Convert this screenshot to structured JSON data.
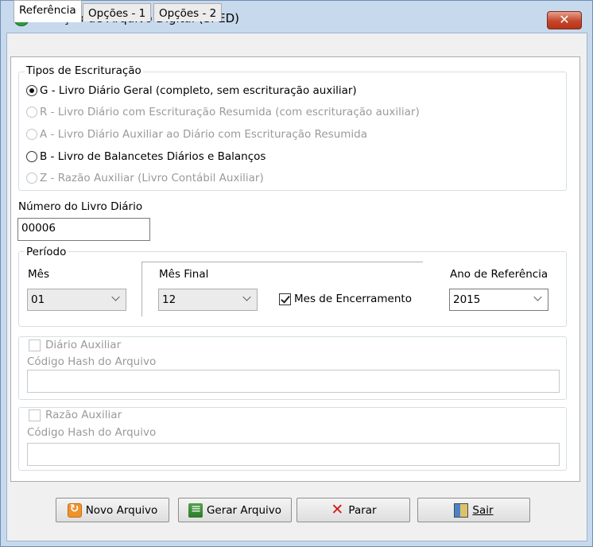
{
  "window": {
    "title": "Geração de Arquivo Digital (SPED)",
    "close_glyph": "✕"
  },
  "tabs": [
    {
      "label": "Referência",
      "active": true
    },
    {
      "label": "Opções - 1",
      "active": false
    },
    {
      "label": "Opções - 2",
      "active": false
    }
  ],
  "tipos": {
    "legend": "Tipos de Escrituração",
    "options": [
      {
        "label": "G - Livro Diário Geral (completo, sem escrituração auxiliar)",
        "checked": true,
        "enabled": true
      },
      {
        "label": "R - Livro Diário com Escrituração Resumida (com escrituração auxiliar)",
        "checked": false,
        "enabled": false
      },
      {
        "label": "A - Livro Diário Auxiliar ao Diário com Escrituração Resumida",
        "checked": false,
        "enabled": false
      },
      {
        "label": "B - Livro de Balancetes Diários e Balanços",
        "checked": false,
        "enabled": true
      },
      {
        "label": "Z - Razão Auxiliar (Livro Contábil Auxiliar)",
        "checked": false,
        "enabled": false
      }
    ]
  },
  "numero_livro": {
    "label": "Número do Livro Diário",
    "value": "00006"
  },
  "periodo": {
    "legend": "Período",
    "mes_label": "Mês",
    "mes_value": "01",
    "mes_final_label": "Mês Final",
    "mes_final_value": "12",
    "encerramento_label": "Mes de Encerramento",
    "encerramento_checked": true,
    "ano_label": "Ano de Referência",
    "ano_value": "2015"
  },
  "diario_auxiliar": {
    "checkbox_label": "Diário Auxiliar",
    "hash_label": "Código Hash do Arquivo",
    "hash_value": ""
  },
  "razao_auxiliar": {
    "checkbox_label": "Razão Auxiliar",
    "hash_label": "Código Hash do Arquivo",
    "hash_value": ""
  },
  "buttons": {
    "novo": "Novo Arquivo",
    "gerar": "Gerar Arquivo",
    "parar": "Parar",
    "sair": "Sair"
  },
  "icons": {
    "app": "green-leaf-icon",
    "novo": "refresh-document-icon",
    "gerar": "spreadsheet-icon",
    "parar": "red-x-icon",
    "sair": "exit-door-icon"
  }
}
